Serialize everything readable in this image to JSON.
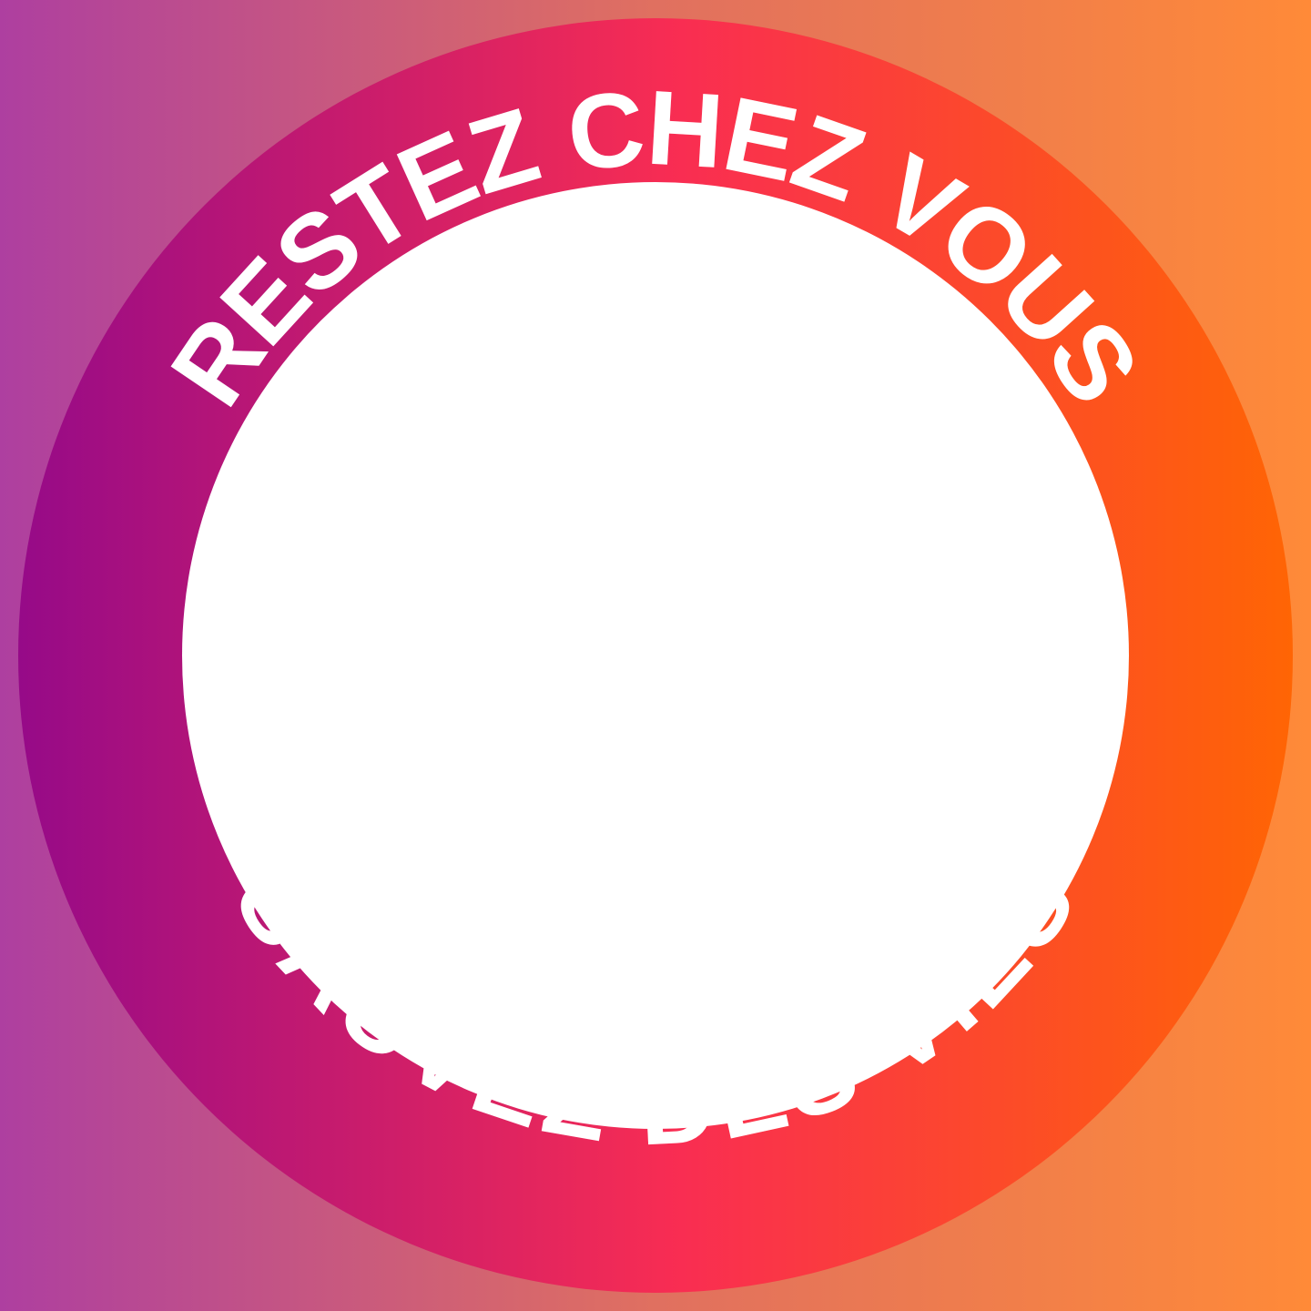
{
  "frame": {
    "top_text": "RESTEZ CHEZ VOUS",
    "bottom_text": "SAUVEZ DES VIES"
  },
  "colors": {
    "background_left": "#AE3FA0",
    "background_mid": "#E07060",
    "background_right": "#FF8A38",
    "ring_left": "#960A88",
    "ring_mid": "#F92D52",
    "ring_right": "#FF6504",
    "text": "#FFFFFF",
    "photo_area": "#FFFFFF"
  }
}
